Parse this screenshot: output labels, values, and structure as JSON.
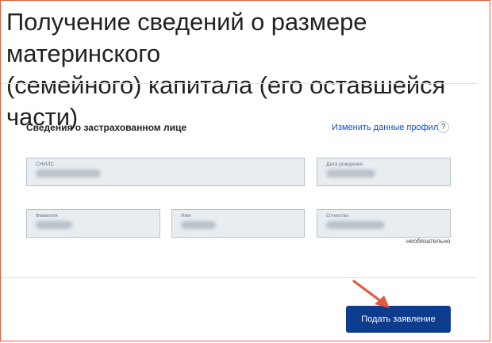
{
  "header": {
    "title_line1": "Получение сведений о размере материнского",
    "title_line2": "(семейного) капитала (его оставшейся части)"
  },
  "insured": {
    "section_title": "Сведения о застрахованном лице",
    "edit_profile_link": "Изменить данные профиля",
    "help_glyph": "?"
  },
  "fields": {
    "snils_label": "СНИЛС",
    "birthdate_label": "Дата рождения",
    "lastname_label": "Фамилия",
    "firstname_label": "Имя",
    "patronymic_label": "Отчество",
    "patronymic_note": "необязательно"
  },
  "actions": {
    "submit_label": "Подать заявление"
  },
  "colors": {
    "accent": "#0d4cd3",
    "button": "#0d3b8e",
    "annotation_arrow": "#e35a3c",
    "field_bg": "#e8edf1"
  }
}
